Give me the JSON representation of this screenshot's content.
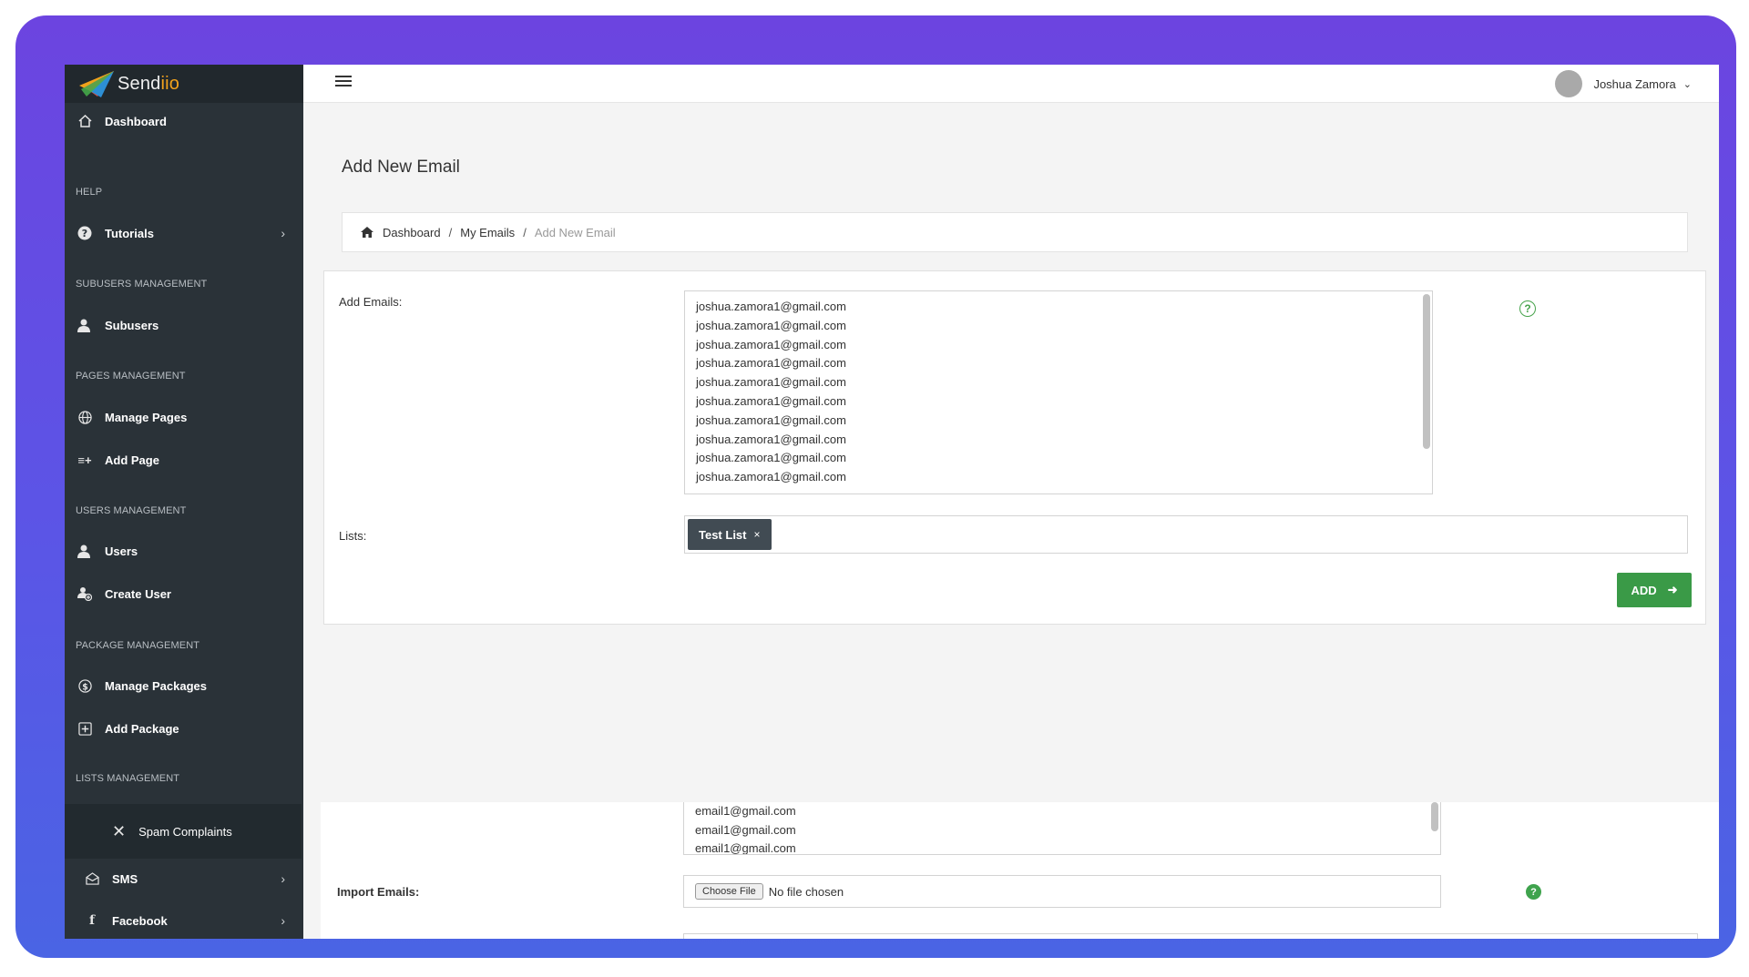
{
  "app": {
    "brand_prefix": "Send",
    "brand_suffix": "iio"
  },
  "sidebar": {
    "dashboard": "Dashboard",
    "sections": {
      "help": "HELP",
      "subusers": "SUBUSERS MANAGEMENT",
      "pages": "PAGES MANAGEMENT",
      "users": "USERS MANAGEMENT",
      "packages": "PACKAGE MANAGEMENT",
      "lists": "LISTS MANAGEMENT"
    },
    "items": {
      "tutorials": "Tutorials",
      "subusers": "Subusers",
      "manage_pages": "Manage Pages",
      "add_page": "Add Page",
      "users": "Users",
      "create_user": "Create User",
      "manage_packages": "Manage Packages",
      "add_package": "Add Package",
      "spam_complaints": "Spam Complaints",
      "sms": "SMS",
      "facebook": "Facebook"
    }
  },
  "topbar": {
    "user_name": "Joshua Zamora"
  },
  "page": {
    "title": "Add New Email",
    "breadcrumb": [
      "Dashboard",
      "My Emails",
      "Add New Email"
    ]
  },
  "form": {
    "add_emails_label": "Add Emails:",
    "emails": [
      "joshua.zamora1@gmail.com",
      "joshua.zamora1@gmail.com",
      "joshua.zamora1@gmail.com",
      "joshua.zamora1@gmail.com",
      "joshua.zamora1@gmail.com",
      "joshua.zamora1@gmail.com",
      "joshua.zamora1@gmail.com",
      "joshua.zamora1@gmail.com",
      "joshua.zamora1@gmail.com",
      "joshua.zamora1@gmail.com"
    ],
    "lists_label": "Lists:",
    "list_tag": "Test List",
    "tag_remove": "×",
    "add_button": "ADD"
  },
  "lower": {
    "emails": [
      "email1@gmail.com",
      "email1@gmail.com",
      "email1@gmail.com"
    ],
    "import_label": "Import Emails:",
    "choose_file": "Choose File",
    "no_file": "No file chosen"
  },
  "colors": {
    "sidebar": "#2a3238",
    "accent_green": "#3a9a47",
    "frame_start": "#6c44e0",
    "frame_end": "#4a64e4",
    "brand_orange": "#f2a21c"
  }
}
